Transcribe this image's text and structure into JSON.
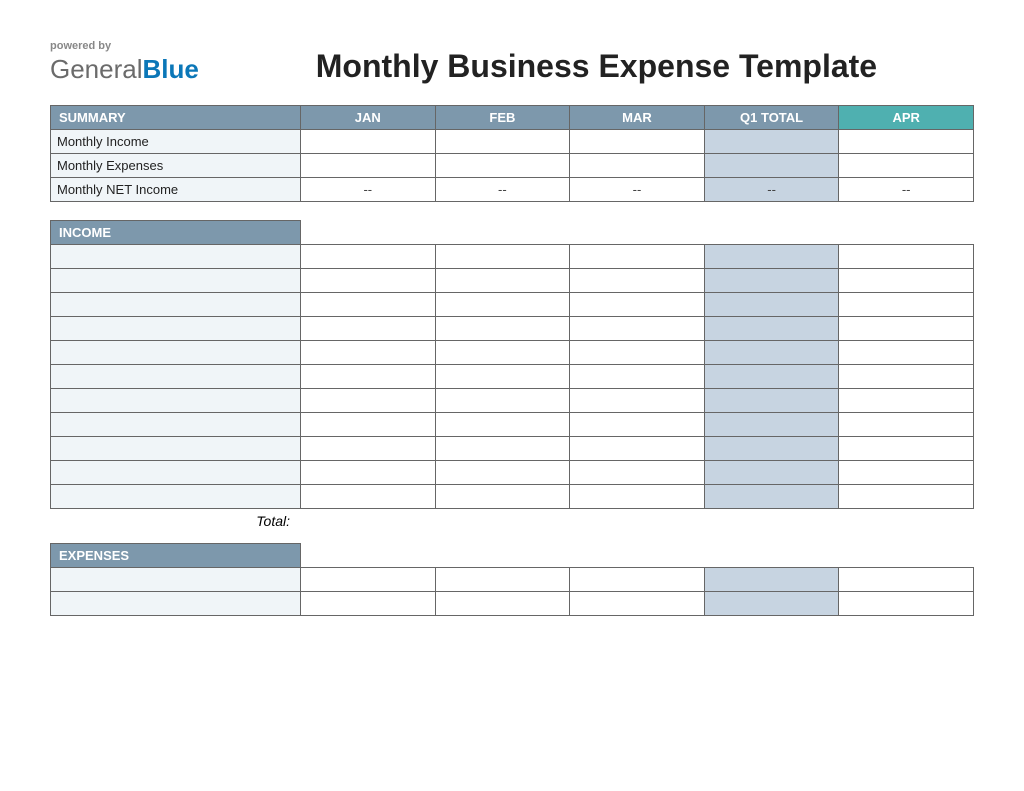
{
  "brand": {
    "powered_by": "powered by",
    "name_part1": "General",
    "name_part2": "Blue"
  },
  "title": "Monthly Business Expense Template",
  "summary": {
    "header": "SUMMARY",
    "columns": [
      "JAN",
      "FEB",
      "MAR",
      "Q1 TOTAL",
      "APR"
    ],
    "rows": [
      {
        "label": "Monthly Income",
        "cells": [
          "",
          "",
          "",
          "",
          ""
        ]
      },
      {
        "label": "Monthly Expenses",
        "cells": [
          "",
          "",
          "",
          "",
          ""
        ]
      },
      {
        "label": "Monthly NET Income",
        "cells": [
          "--",
          "--",
          "--",
          "--",
          "--"
        ]
      }
    ]
  },
  "income": {
    "header": "INCOME",
    "row_count": 11,
    "total_label": "Total:"
  },
  "expenses": {
    "header": "EXPENSES",
    "row_count": 2
  },
  "chart_data": {
    "type": "table",
    "title": "Monthly Business Expense Template",
    "columns": [
      "",
      "JAN",
      "FEB",
      "MAR",
      "Q1 TOTAL",
      "APR"
    ],
    "sections": [
      {
        "name": "SUMMARY",
        "rows": [
          [
            "Monthly Income",
            "",
            "",
            "",
            "",
            ""
          ],
          [
            "Monthly Expenses",
            "",
            "",
            "",
            "",
            ""
          ],
          [
            "Monthly NET Income",
            "--",
            "--",
            "--",
            "--",
            "--"
          ]
        ]
      },
      {
        "name": "INCOME",
        "rows": [
          [
            "",
            "",
            "",
            "",
            "",
            ""
          ],
          [
            "",
            "",
            "",
            "",
            "",
            ""
          ],
          [
            "",
            "",
            "",
            "",
            "",
            ""
          ],
          [
            "",
            "",
            "",
            "",
            "",
            ""
          ],
          [
            "",
            "",
            "",
            "",
            "",
            ""
          ],
          [
            "",
            "",
            "",
            "",
            "",
            ""
          ],
          [
            "",
            "",
            "",
            "",
            "",
            ""
          ],
          [
            "",
            "",
            "",
            "",
            "",
            ""
          ],
          [
            "",
            "",
            "",
            "",
            "",
            ""
          ],
          [
            "",
            "",
            "",
            "",
            "",
            ""
          ],
          [
            "",
            "",
            "",
            "",
            "",
            ""
          ]
        ],
        "footer": [
          "Total:",
          "",
          "",
          "",
          "",
          ""
        ]
      },
      {
        "name": "EXPENSES",
        "rows": [
          [
            "",
            "",
            "",
            "",
            "",
            ""
          ],
          [
            "",
            "",
            "",
            "",
            "",
            ""
          ]
        ]
      }
    ]
  }
}
